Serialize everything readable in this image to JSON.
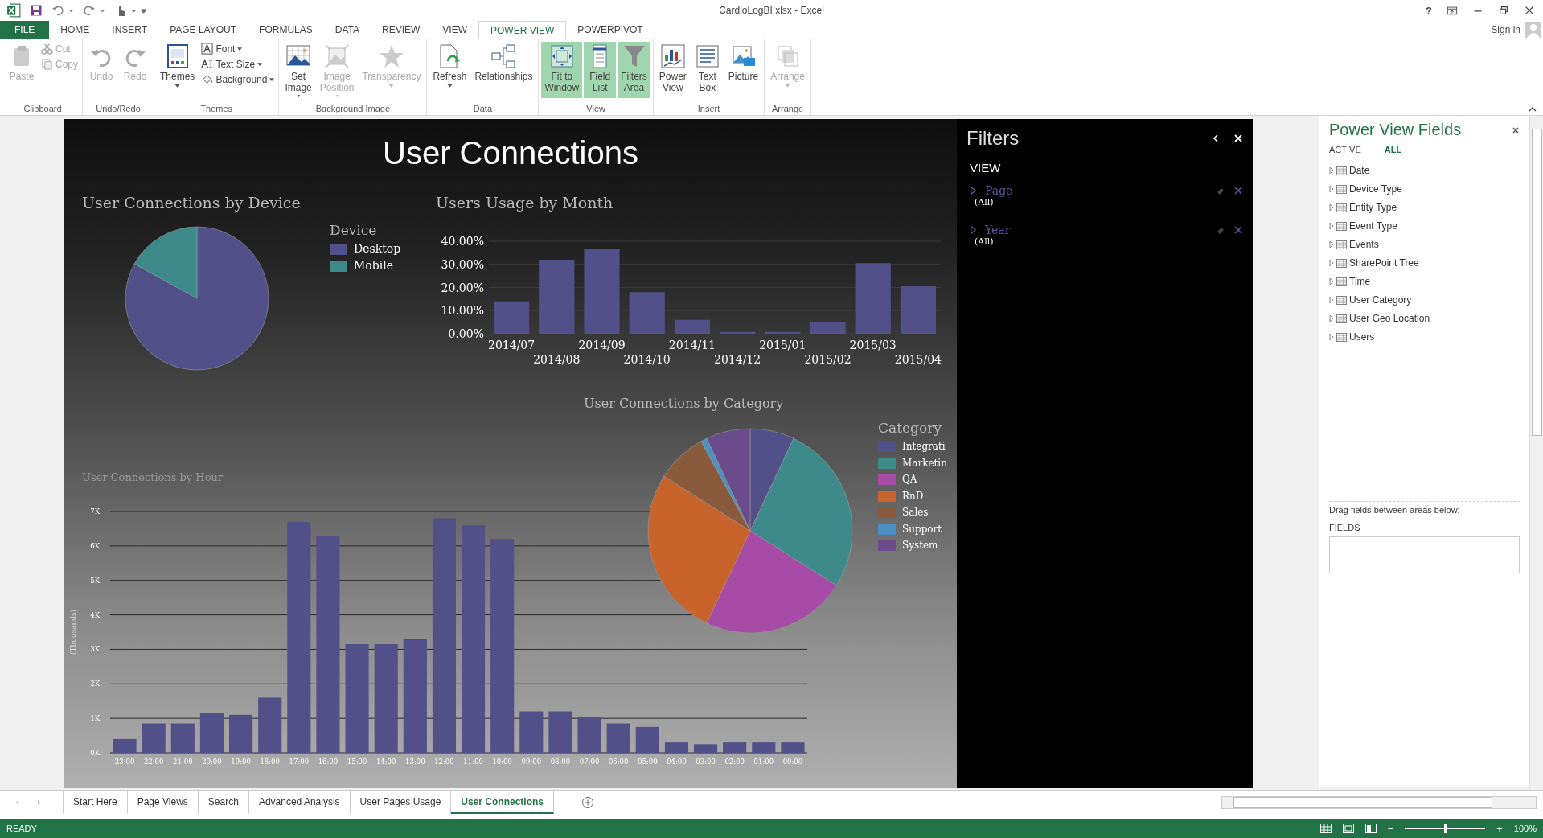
{
  "window": {
    "title": "CardioLogBI.xlsx - Excel",
    "help": "?"
  },
  "account": {
    "sign_in": "Sign in"
  },
  "ribbon_tabs": [
    {
      "label": "FILE",
      "kind": "file",
      "selected": false
    },
    {
      "label": "HOME",
      "kind": "tab",
      "selected": false
    },
    {
      "label": "INSERT",
      "kind": "tab",
      "selected": false
    },
    {
      "label": "PAGE LAYOUT",
      "kind": "tab",
      "selected": false
    },
    {
      "label": "FORMULAS",
      "kind": "tab",
      "selected": false
    },
    {
      "label": "DATA",
      "kind": "tab",
      "selected": false
    },
    {
      "label": "REVIEW",
      "kind": "tab",
      "selected": false
    },
    {
      "label": "VIEW",
      "kind": "tab",
      "selected": false
    },
    {
      "label": "POWER VIEW",
      "kind": "tab",
      "selected": true
    },
    {
      "label": "POWERPIVOT",
      "kind": "tab",
      "selected": false
    }
  ],
  "ribbon_groups": [
    {
      "name": "Clipboard",
      "buttons": [
        {
          "label": "Paste",
          "kind": "large",
          "disabled": true,
          "on": false,
          "dropdown": false
        },
        {
          "label": "Cut",
          "kind": "small",
          "disabled": true,
          "on": false,
          "dropdown": false
        },
        {
          "label": "Copy",
          "kind": "small",
          "disabled": true,
          "on": false,
          "dropdown": false
        }
      ]
    },
    {
      "name": "Undo/Redo",
      "buttons": [
        {
          "label": "Undo",
          "kind": "large",
          "disabled": true,
          "on": false,
          "dropdown": false
        },
        {
          "label": "Redo",
          "kind": "large",
          "disabled": true,
          "on": false,
          "dropdown": false
        }
      ]
    },
    {
      "name": "Themes",
      "buttons": [
        {
          "label": "Themes",
          "kind": "large",
          "disabled": false,
          "on": false,
          "dropdown": true
        },
        {
          "label": "Font",
          "kind": "small",
          "disabled": false,
          "on": false,
          "dropdown": true
        },
        {
          "label": "Text Size",
          "kind": "small",
          "disabled": false,
          "on": false,
          "dropdown": true
        },
        {
          "label": "Background",
          "kind": "small",
          "disabled": false,
          "on": false,
          "dropdown": true
        }
      ]
    },
    {
      "name": "Background Image",
      "buttons": [
        {
          "label": "Set\nImage",
          "kind": "large",
          "disabled": false,
          "on": false,
          "dropdown": true
        },
        {
          "label": "Image\nPosition",
          "kind": "large",
          "disabled": true,
          "on": false,
          "dropdown": true
        },
        {
          "label": "Transparency",
          "kind": "large",
          "disabled": true,
          "on": false,
          "dropdown": true
        }
      ]
    },
    {
      "name": "Data",
      "buttons": [
        {
          "label": "Refresh",
          "kind": "large",
          "disabled": false,
          "on": false,
          "dropdown": true
        },
        {
          "label": "Relationships",
          "kind": "large",
          "disabled": false,
          "on": false,
          "dropdown": false
        }
      ]
    },
    {
      "name": "View",
      "buttons": [
        {
          "label": "Fit to\nWindow",
          "kind": "large",
          "disabled": false,
          "on": true,
          "dropdown": false
        },
        {
          "label": "Field\nList",
          "kind": "large",
          "disabled": false,
          "on": true,
          "dropdown": false
        },
        {
          "label": "Filters\nArea",
          "kind": "large",
          "disabled": false,
          "on": true,
          "dropdown": false
        }
      ]
    },
    {
      "name": "Insert",
      "buttons": [
        {
          "label": "Power\nView",
          "kind": "large",
          "disabled": false,
          "on": false,
          "dropdown": false
        },
        {
          "label": "Text\nBox",
          "kind": "large",
          "disabled": false,
          "on": false,
          "dropdown": false
        },
        {
          "label": "Picture",
          "kind": "large",
          "disabled": false,
          "on": false,
          "dropdown": false
        }
      ]
    },
    {
      "name": "Arrange",
      "buttons": [
        {
          "label": "Arrange",
          "kind": "large",
          "disabled": true,
          "on": false,
          "dropdown": true
        }
      ]
    }
  ],
  "report": {
    "title": "User Connections",
    "device_chart": {
      "title": "User Connections by Device",
      "legend_title": "Device",
      "legend": [
        {
          "label": "Desktop",
          "color": "#525089"
        },
        {
          "label": "Mobile",
          "color": "#3e8a8a"
        }
      ]
    },
    "month_chart": {
      "chart_data": {
        "type": "bar",
        "title": "Users Usage by Month",
        "categories": [
          "2014/07",
          "2014/08",
          "2014/09",
          "2014/10",
          "2014/11",
          "2014/12",
          "2015/01",
          "2015/02",
          "2015/03",
          "2015/04"
        ],
        "values": [
          14,
          32,
          36.5,
          18,
          6,
          0.8,
          0.8,
          5,
          30.5,
          20.5
        ],
        "ylim": [
          0,
          40
        ],
        "grid": true,
        "yticks": [
          {
            "value": 0,
            "label": "0.00%"
          },
          {
            "value": 10,
            "label": "10.00%"
          },
          {
            "value": 20,
            "label": "20.00%"
          },
          {
            "value": 30,
            "label": "30.00%"
          },
          {
            "value": 40,
            "label": "40.00%"
          }
        ]
      }
    },
    "category_chart": {
      "title": "User Connections by Category",
      "legend_title": "Category",
      "legend": [
        {
          "label": "Integrati",
          "color": "#525089"
        },
        {
          "label": "Marketin",
          "color": "#3e8a8a"
        },
        {
          "label": "QA",
          "color": "#a64ca6"
        },
        {
          "label": "RnD",
          "color": "#c8632b"
        },
        {
          "label": "Sales",
          "color": "#8a5a3c"
        },
        {
          "label": "Support",
          "color": "#4a90c0"
        },
        {
          "label": "System",
          "color": "#6a4c8c"
        }
      ]
    },
    "hour_chart": {
      "chart_data": {
        "type": "bar",
        "title": "User Connections by Hour",
        "ylabel": "(Thousands)",
        "categories": [
          "23:00",
          "22:00",
          "21:00",
          "20:00",
          "19:00",
          "18:00",
          "17:00",
          "16:00",
          "15:00",
          "14:00",
          "13:00",
          "12:00",
          "11:00",
          "10:00",
          "09:00",
          "08:00",
          "07:00",
          "06:00",
          "05:00",
          "04:00",
          "03:00",
          "02:00",
          "01:00",
          "00:00"
        ],
        "values": [
          0.4,
          0.85,
          0.85,
          1.15,
          1.1,
          1.6,
          6.7,
          6.3,
          3.15,
          3.15,
          3.3,
          6.8,
          6.6,
          6.2,
          1.2,
          1.2,
          1.05,
          0.85,
          0.75,
          0.3,
          0.25,
          0.3,
          0.3,
          0.3
        ],
        "ylim": [
          0,
          7
        ],
        "grid": true,
        "yticks": [
          {
            "value": 0,
            "label": "0K"
          },
          {
            "value": 1,
            "label": "1K"
          },
          {
            "value": 2,
            "label": "2K"
          },
          {
            "value": 3,
            "label": "3K"
          },
          {
            "value": 4,
            "label": "4K"
          },
          {
            "value": 5,
            "label": "5K"
          },
          {
            "value": 6,
            "label": "6K"
          },
          {
            "value": 7,
            "label": "7K"
          }
        ]
      }
    }
  },
  "filters_pane": {
    "title": "Filters",
    "section": "VIEW",
    "filters": [
      {
        "name": "Page",
        "value": "(All)"
      },
      {
        "name": "Year",
        "value": "(All)"
      }
    ]
  },
  "fields_pane": {
    "title": "Power View Fields",
    "tabs": [
      {
        "label": "ACTIVE",
        "selected": false
      },
      {
        "label": "ALL",
        "selected": true
      }
    ],
    "tables": [
      "Date",
      "Device Type",
      "Entity Type",
      "Event Type",
      "Events",
      "SharePoint Tree",
      "Time",
      "User Category",
      "User Geo Location",
      "Users"
    ],
    "hint": "Drag fields between areas below:",
    "area_label": "FIELDS"
  },
  "sheet_tabs": [
    {
      "label": "Start Here",
      "selected": false
    },
    {
      "label": "Page Views",
      "selected": false
    },
    {
      "label": "Search",
      "selected": false
    },
    {
      "label": "Advanced Analysis",
      "selected": false
    },
    {
      "label": "User Pages Usage",
      "selected": false
    },
    {
      "label": "User Connections",
      "selected": true
    }
  ],
  "status_bar": {
    "status": "READY",
    "zoom_out": "−",
    "zoom_slider": {
      "level": 0.5
    },
    "zoom_in": "+",
    "zoom": "100%"
  }
}
